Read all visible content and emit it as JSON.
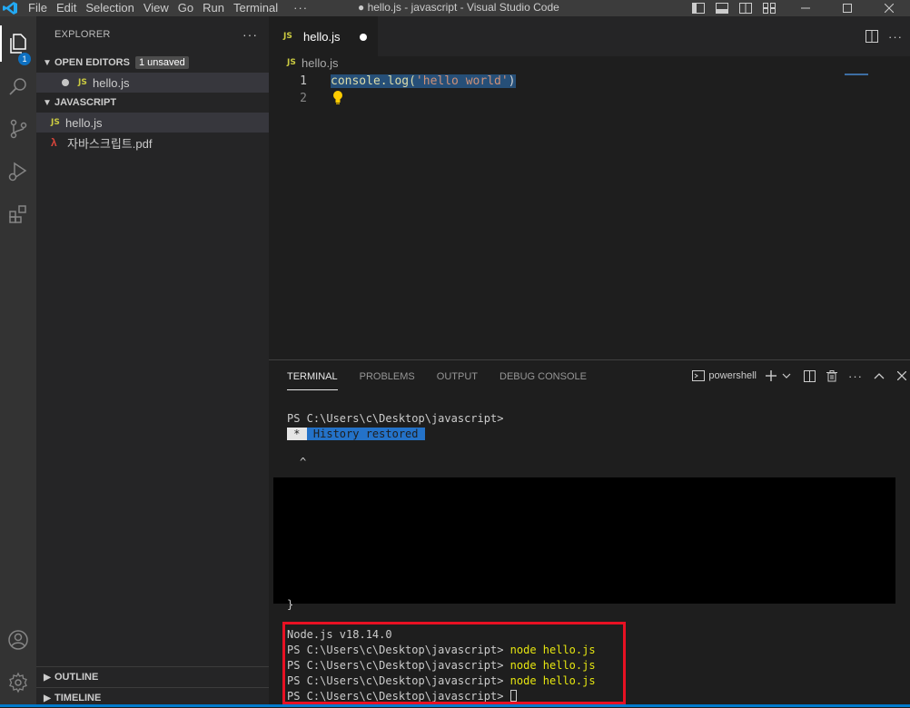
{
  "titlebar": {
    "menu": [
      "File",
      "Edit",
      "Selection",
      "View",
      "Go",
      "Run",
      "Terminal"
    ],
    "more": "···",
    "window_title": "● hello.js - javascript - Visual Studio Code"
  },
  "activity": {
    "explorer_badge": "1"
  },
  "sidebar": {
    "title": "EXPLORER",
    "more": "···",
    "open_editors": {
      "label": "OPEN EDITORS",
      "badge": "1 unsaved",
      "file": "hello.js",
      "file_icon": "JS"
    },
    "folder": {
      "label": "JAVASCRIPT",
      "files": [
        {
          "name": "hello.js",
          "icon": "JS"
        },
        {
          "name": "자바스크립트.pdf",
          "icon": "pdf-icon"
        }
      ]
    },
    "outline": "OUTLINE",
    "timeline": "TIMELINE"
  },
  "editor": {
    "tab": {
      "label": "hello.js",
      "icon": "JS"
    },
    "breadcrumb": {
      "label": "hello.js",
      "icon": "JS"
    },
    "lines": [
      {
        "number": "1",
        "fn": "console.log(",
        "str": "'hello world'",
        "end": ")"
      },
      {
        "number": "2"
      }
    ]
  },
  "panel": {
    "tabs": [
      "TERMINAL",
      "PROBLEMS",
      "OUTPUT",
      "DEBUG CONSOLE"
    ],
    "shell": "powershell",
    "terminal": {
      "line1": "PS C:\\Users\\c\\Desktop\\javascript>",
      "history_star": " * ",
      "history_text": " History restored ",
      "caret": "^",
      "brace": "}",
      "node_version": "Node.js v18.14.0",
      "prompt": "PS C:\\Users\\c\\Desktop\\javascript>",
      "command": "node hello.js"
    }
  },
  "colors": {
    "accent": "#007acc",
    "highlight_box": "#e81123",
    "selection": "#264f78"
  }
}
